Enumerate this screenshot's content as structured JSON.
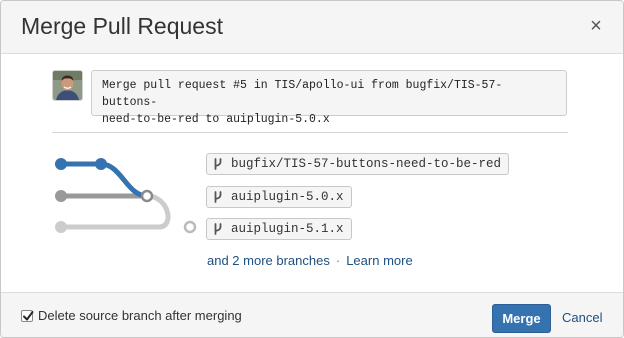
{
  "dialog": {
    "title": "Merge Pull Request",
    "close_label": "×"
  },
  "commit_message": {
    "line1": "Merge pull request #5 in TIS/apollo-ui from bugfix/TIS-57-buttons-",
    "line2": "need-to-be-red to auiplugin-5.0.x"
  },
  "branches": [
    {
      "name": "bugfix/TIS-57-buttons-need-to-be-red",
      "color": "#3572b0"
    },
    {
      "name": "auiplugin-5.0.x",
      "color": "#999999"
    },
    {
      "name": "auiplugin-5.1.x",
      "color": "#cccccc"
    }
  ],
  "more": {
    "branches_link": "and 2 more branches",
    "separator": "·",
    "learn_more": "Learn more"
  },
  "footer": {
    "delete_checkbox_label": "Delete source branch after merging",
    "delete_checked": true,
    "merge_label": "Merge",
    "cancel_label": "Cancel"
  },
  "colors": {
    "primary": "#3572b0",
    "link": "#205081"
  }
}
